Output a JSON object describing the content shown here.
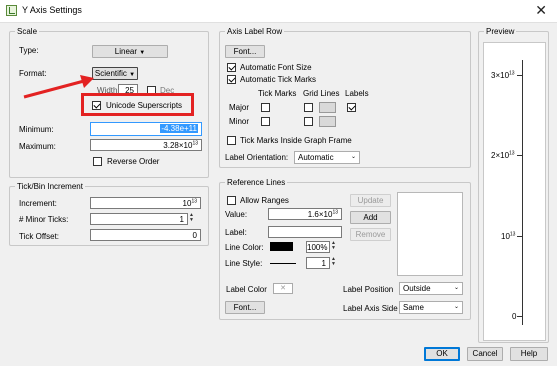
{
  "window": {
    "title": "Y Axis Settings",
    "close": "✕"
  },
  "scale": {
    "legend": "Scale",
    "type_label": "Type:",
    "type_value": "Linear",
    "format_label": "Format:",
    "format_value": "Scientific",
    "width_label": "Width",
    "width_value": "25",
    "dec_label": "Dec",
    "unicode_superscripts_label": "Unicode Superscripts",
    "unicode_superscripts_checked": true,
    "minimum_label": "Minimum:",
    "minimum_value": "-4.38e+11",
    "maximum_label": "Maximum:",
    "maximum_base": "3.28×10",
    "maximum_exp": "13",
    "reverse_order_label": "Reverse Order"
  },
  "tick_bin": {
    "legend": "Tick/Bin Increment",
    "increment_label": "Increment:",
    "increment_base": "10",
    "increment_exp": "13",
    "minor_ticks_label": "# Minor Ticks:",
    "minor_ticks_value": "1",
    "tick_offset_label": "Tick Offset:",
    "tick_offset_value": "0"
  },
  "axis_label_row": {
    "legend": "Axis Label Row",
    "font_button": "Font...",
    "auto_font_size": "Automatic Font Size",
    "auto_tick_marks": "Automatic Tick Marks",
    "col_tick_marks": "Tick Marks",
    "col_grid_lines": "Grid Lines",
    "col_labels": "Labels",
    "major_label": "Major",
    "minor_label": "Minor",
    "inside_frame": "Tick Marks Inside Graph Frame",
    "orientation_label": "Label Orientation:",
    "orientation_value": "Automatic"
  },
  "reference_lines": {
    "legend": "Reference Lines",
    "allow_ranges": "Allow Ranges",
    "value_label": "Value:",
    "value_base": "1.6×10",
    "value_exp": "13",
    "label_label": "Label:",
    "line_color_label": "Line Color:",
    "opacity_value": "100%",
    "line_style_label": "Line Style:",
    "line_width_value": "1",
    "update_button": "Update",
    "add_button": "Add",
    "remove_button": "Remove",
    "label_color_label": "Label Color",
    "label_position_label": "Label Position",
    "label_position_value": "Outside",
    "label_axis_side_label": "Label Axis Side",
    "label_axis_side_value": "Same",
    "font_button": "Font..."
  },
  "preview": {
    "legend": "Preview",
    "ticks": [
      {
        "base": "3×10",
        "exp": "13"
      },
      {
        "base": "2×10",
        "exp": "13"
      },
      {
        "base": "10",
        "exp": "13"
      },
      {
        "base": "0",
        "exp": ""
      }
    ]
  },
  "footer": {
    "ok": "OK",
    "cancel": "Cancel",
    "help": "Help"
  },
  "colors": {
    "annotation": "#e32222",
    "selection": "#3399ff",
    "line_color": "#000000"
  },
  "icons": {
    "title": "jmp-app-icon",
    "dropdown": "dropdown-arrow-icon"
  }
}
